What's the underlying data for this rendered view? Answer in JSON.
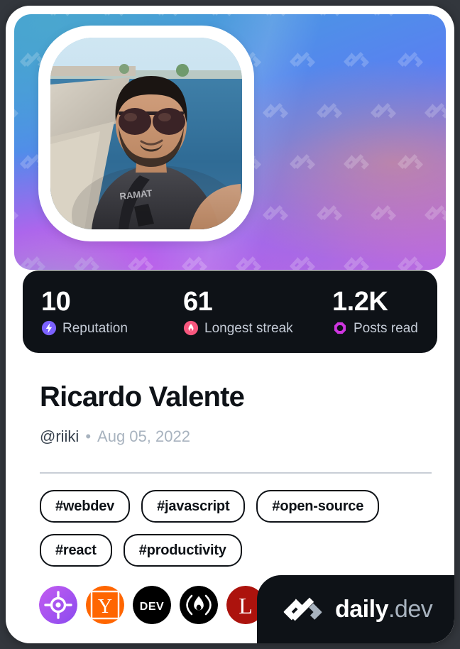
{
  "card": {
    "background_color": "#ffffff",
    "page_background": "#33373d"
  },
  "cover": {
    "watermark_icon": "daily-dev-logo-watermark",
    "gradient_colors": [
      "#3f9fd4",
      "#4f8fe8",
      "#5b7ef2",
      "#7b6ff0",
      "#b062e2",
      "#d75ae8"
    ]
  },
  "avatar": {
    "alt": "Ricardo Valente profile photo",
    "icon": "avatar-photo"
  },
  "stats": [
    {
      "value": "10",
      "label": "Reputation",
      "icon": "reputation-bolt-icon",
      "color": "#7b61ff"
    },
    {
      "value": "61",
      "label": "Longest streak",
      "icon": "streak-flame-icon",
      "color": "#f8577e"
    },
    {
      "value": "1.2K",
      "label": "Posts read",
      "icon": "posts-read-ring-icon",
      "color": "#cf35e0"
    }
  ],
  "profile": {
    "name": "Ricardo Valente",
    "handle": "@riiki",
    "separator": "•",
    "joined": "Aug 05, 2022"
  },
  "tags": [
    {
      "label": "#webdev"
    },
    {
      "label": "#javascript"
    },
    {
      "label": "#open-source"
    },
    {
      "label": "#react"
    },
    {
      "label": "#productivity"
    }
  ],
  "socials": [
    {
      "name": "roadmapsh",
      "icon": "roadmap-target-icon",
      "color": "#b04be0"
    },
    {
      "name": "hackernews",
      "icon": "hacker-news-y-icon",
      "color": "#ff6600"
    },
    {
      "name": "devto",
      "icon": "dev-to-icon",
      "color": "#000000"
    },
    {
      "name": "hashnode",
      "icon": "flame-circle-icon",
      "color": "#000000"
    },
    {
      "name": "lobsters",
      "icon": "lobsters-l-icon",
      "color": "#ac130d"
    }
  ],
  "brand": {
    "mark_icon": "daily-dev-logo-mark",
    "name": "daily",
    "suffix": ".dev",
    "background": "#0e1217"
  }
}
